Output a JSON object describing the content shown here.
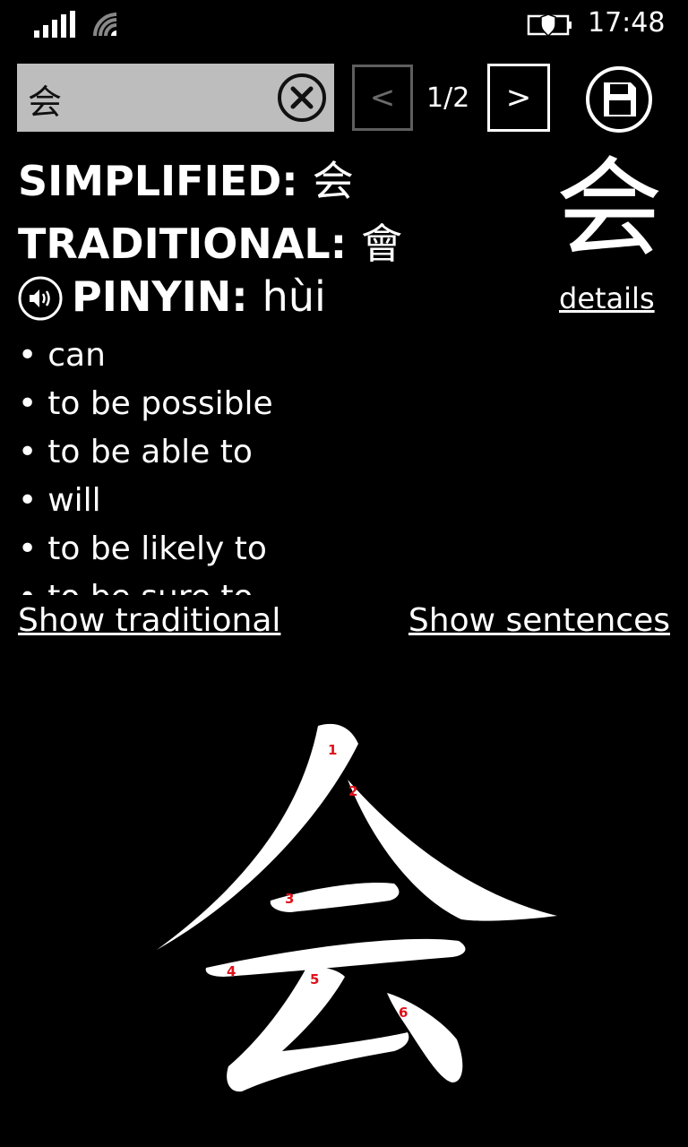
{
  "status_bar": {
    "time": "17:48",
    "icons": [
      "signal-icon",
      "wifi-icon",
      "battery-saver-icon"
    ]
  },
  "search": {
    "value": "会",
    "clear_icon": "close-circle-icon"
  },
  "pager": {
    "prev_label": "<",
    "page": "1/2",
    "next_label": ">",
    "save_icon": "floppy-disk-icon"
  },
  "entry": {
    "simplified_label": "SIMPLIFIED:",
    "simplified_value": "会",
    "traditional_label": "TRADITIONAL:",
    "traditional_value": "會",
    "pinyin_label": "PINYIN:",
    "pinyin_value": "hùi",
    "speaker_icon": "speaker-icon",
    "big_char": "会",
    "details_label": "details"
  },
  "meanings": [
    "can",
    "to be possible",
    "to be able to",
    "will",
    "to be likely to",
    "to be sure to"
  ],
  "links": {
    "show_traditional": "Show traditional",
    "show_sentences": "Show sentences"
  },
  "stroke_diagram": {
    "stroke_count": 6,
    "labels": [
      "1",
      "2",
      "3",
      "4",
      "5",
      "6"
    ],
    "number_color": "#e0101a"
  }
}
